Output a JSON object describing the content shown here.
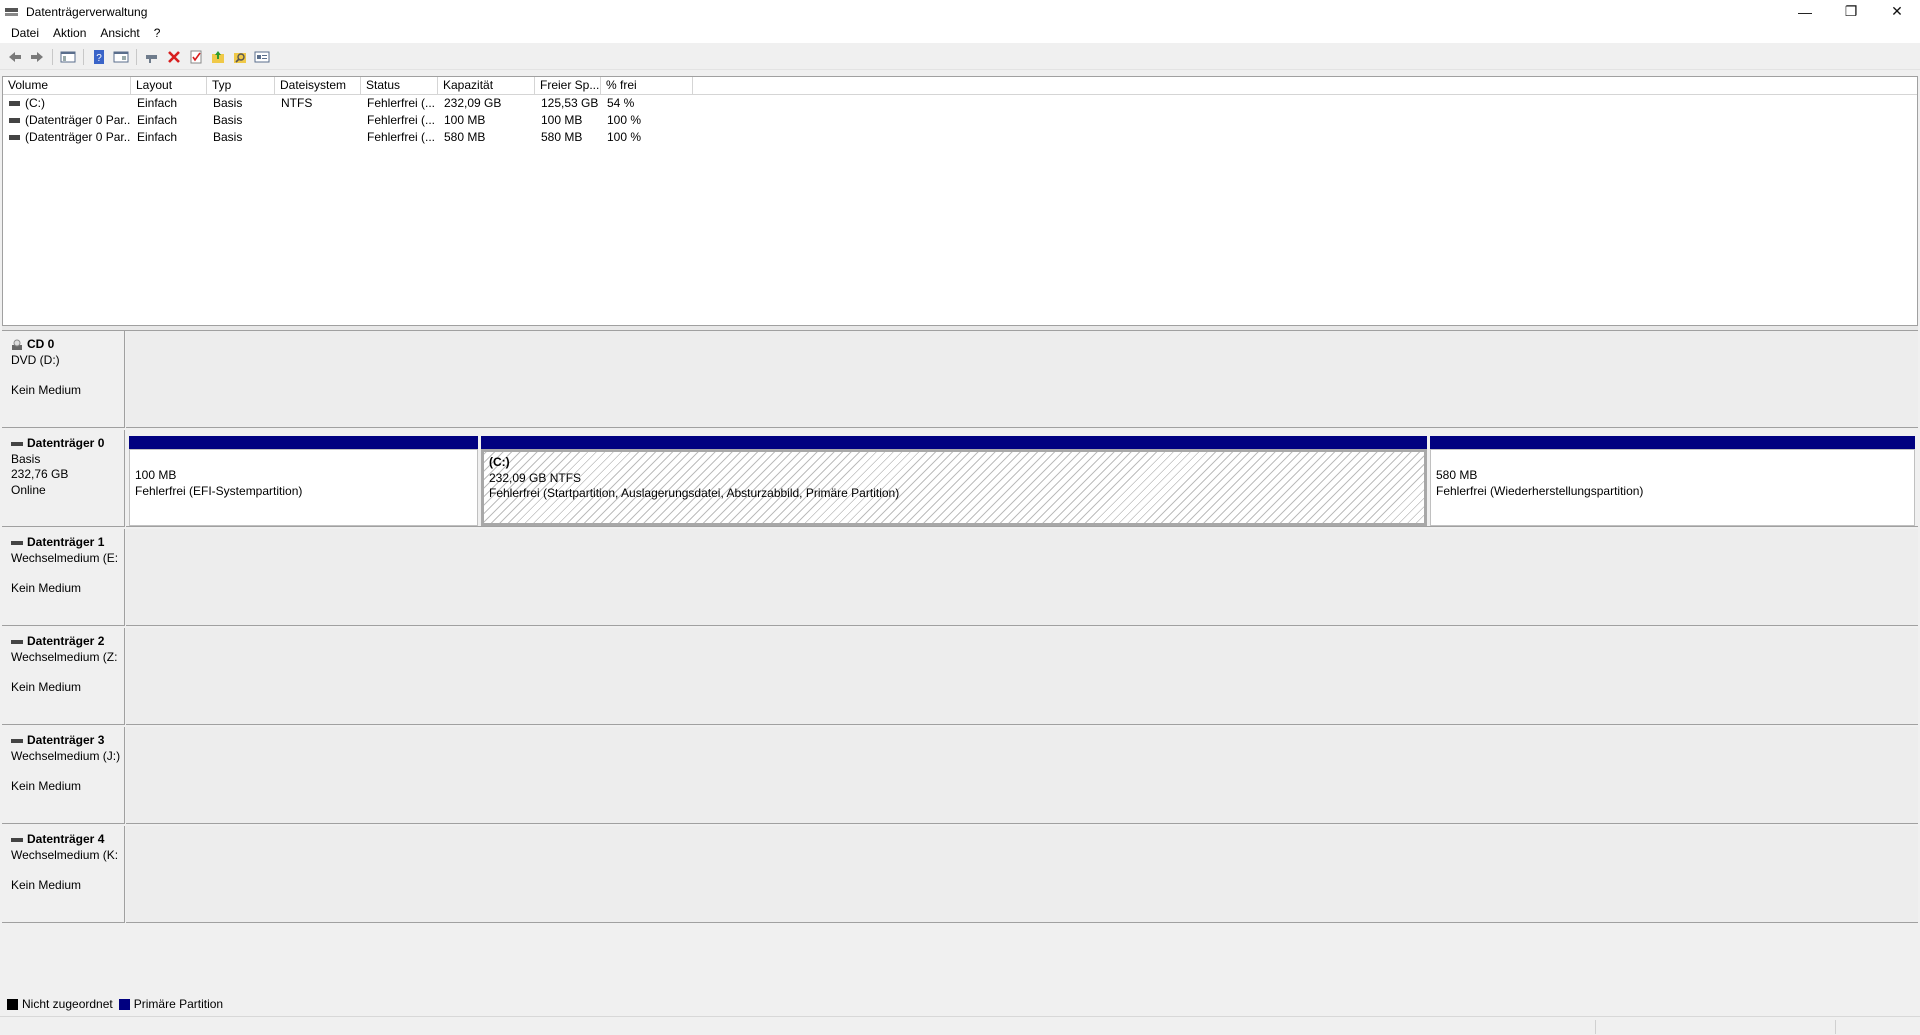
{
  "window": {
    "title": "Datenträgerverwaltung",
    "minimize": "—",
    "restore": "❐",
    "close": "✕"
  },
  "menu": [
    "Datei",
    "Aktion",
    "Ansicht",
    "?"
  ],
  "toolbar": [
    "back-icon",
    "forward-icon",
    "console-tree-icon",
    "help-icon",
    "properties-icon",
    "connect-icon",
    "delete-icon",
    "check-icon",
    "folder-up-icon",
    "folder-search-icon",
    "view-icon"
  ],
  "volume_list": {
    "columns": [
      "Volume",
      "Layout",
      "Typ",
      "Dateisystem",
      "Status",
      "Kapazität",
      "Freier Sp...",
      "% frei"
    ],
    "rows": [
      [
        "(C:)",
        "Einfach",
        "Basis",
        "NTFS",
        "Fehlerfrei (...",
        "232,09 GB",
        "125,53 GB",
        "54 %"
      ],
      [
        "(Datenträger 0 Par...",
        "Einfach",
        "Basis",
        "",
        "Fehlerfrei (...",
        "100 MB",
        "100 MB",
        "100 %"
      ],
      [
        "(Datenträger 0 Par...",
        "Einfach",
        "Basis",
        "",
        "Fehlerfrei (...",
        "580 MB",
        "580 MB",
        "100 %"
      ]
    ]
  },
  "disks": {
    "cd0": {
      "name": "CD 0",
      "line1": "DVD (D:)",
      "line3": "Kein Medium"
    },
    "disk0": {
      "name": "Datenträger 0",
      "line1": "Basis",
      "line2": "232,76 GB",
      "line3": "Online",
      "partitions": {
        "efi": {
          "size": "100 MB",
          "status": "Fehlerfrei (EFI-Systempartition)"
        },
        "c": {
          "name": "(C:)",
          "size": "232,09 GB NTFS",
          "status": "Fehlerfrei (Startpartition, Auslagerungsdatei, Absturzabbild, Primäre Partition)"
        },
        "recovery": {
          "size": "580 MB",
          "status": "Fehlerfrei (Wiederherstellungspartition)"
        }
      }
    },
    "disk1": {
      "name": "Datenträger 1",
      "line1": "Wechselmedium (E:",
      "line3": "Kein Medium"
    },
    "disk2": {
      "name": "Datenträger 2",
      "line1": "Wechselmedium (Z:",
      "line3": "Kein Medium"
    },
    "disk3": {
      "name": "Datenträger 3",
      "line1": "Wechselmedium (J:)",
      "line3": "Kein Medium"
    },
    "disk4": {
      "name": "Datenträger 4",
      "line1": "Wechselmedium (K:",
      "line3": "Kein Medium"
    }
  },
  "legend": {
    "unallocated": {
      "label": "Nicht zugeordnet",
      "color": "#000000"
    },
    "primary": {
      "label": "Primäre Partition",
      "color": "#000080"
    }
  }
}
